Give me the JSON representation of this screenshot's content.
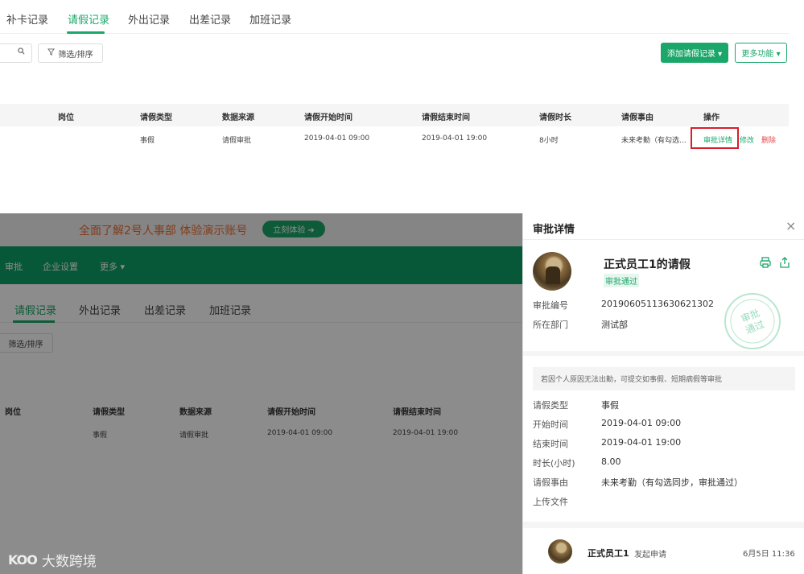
{
  "top": {
    "tabs": [
      {
        "label": "补卡记录",
        "active": false
      },
      {
        "label": "请假记录",
        "active": true
      },
      {
        "label": "外出记录",
        "active": false
      },
      {
        "label": "出差记录",
        "active": false
      },
      {
        "label": "加班记录",
        "active": false
      }
    ],
    "filter_label": "筛选/排序",
    "add_button": "添加请假记录 ▾",
    "more_button": "更多功能 ▾",
    "table": {
      "headers": [
        "岗位",
        "请假类型",
        "数据来源",
        "请假开始时间",
        "请假结束时间",
        "请假时长",
        "请假事由",
        "操作"
      ],
      "row": {
        "type": "事假",
        "source": "请假审批",
        "start": "2019-04-01 09:00",
        "end": "2019-04-01 19:00",
        "duration": "8小时",
        "reason": "未来考勤（有勾选...",
        "actions": {
          "detail": "审批详情",
          "edit": "修改",
          "delete": "删除"
        }
      }
    }
  },
  "bottom": {
    "banner_text": "全面了解2号人事部  体验演示账号",
    "banner_button": "立刻体验 ➔",
    "nav": [
      "审批",
      "企业设置",
      "更多 ▾"
    ],
    "tabs": [
      {
        "label": "请假记录",
        "active": true
      },
      {
        "label": "外出记录",
        "active": false
      },
      {
        "label": "出差记录",
        "active": false
      },
      {
        "label": "加班记录",
        "active": false
      }
    ],
    "filter_label": "筛选/排序",
    "table": {
      "headers": [
        "岗位",
        "请假类型",
        "数据来源",
        "请假开始时间",
        "请假结束时间"
      ],
      "row": {
        "type": "事假",
        "source": "请假审批",
        "start": "2019-04-01 09:00",
        "end": "2019-04-01 19:00"
      }
    },
    "watermark": "大数跨境",
    "watermark_logo": "KOO"
  },
  "panel": {
    "title": "审批详情",
    "close": "×",
    "request_title": "正式员工1的请假",
    "status": "审批通过",
    "fields": [
      {
        "label": "审批编号",
        "value": "20190605113630621302"
      },
      {
        "label": "所在部门",
        "value": "测试部"
      }
    ],
    "stamp_text": [
      "审批",
      "通过"
    ],
    "notice": "若因个人原因无法出勤，可提交如事假、短期病假等审批",
    "details": [
      {
        "label": "请假类型",
        "value": "事假"
      },
      {
        "label": "开始时间",
        "value": "2019-04-01 09:00"
      },
      {
        "label": "结束时间",
        "value": "2019-04-01 19:00"
      },
      {
        "label": "时长(小时)",
        "value": "8.00"
      },
      {
        "label": "请假事由",
        "value": "未来考勤（有勾选同步，审批通过）"
      },
      {
        "label": "上传文件",
        "value": ""
      }
    ],
    "timeline": {
      "name": "正式员工1",
      "action": "发起申请",
      "time": "6月5日 11:36"
    }
  },
  "colors": {
    "accent": "#1aa769",
    "highlight": "#d81e2a",
    "danger": "#e84a4a",
    "banner_text": "#f06b2e"
  }
}
